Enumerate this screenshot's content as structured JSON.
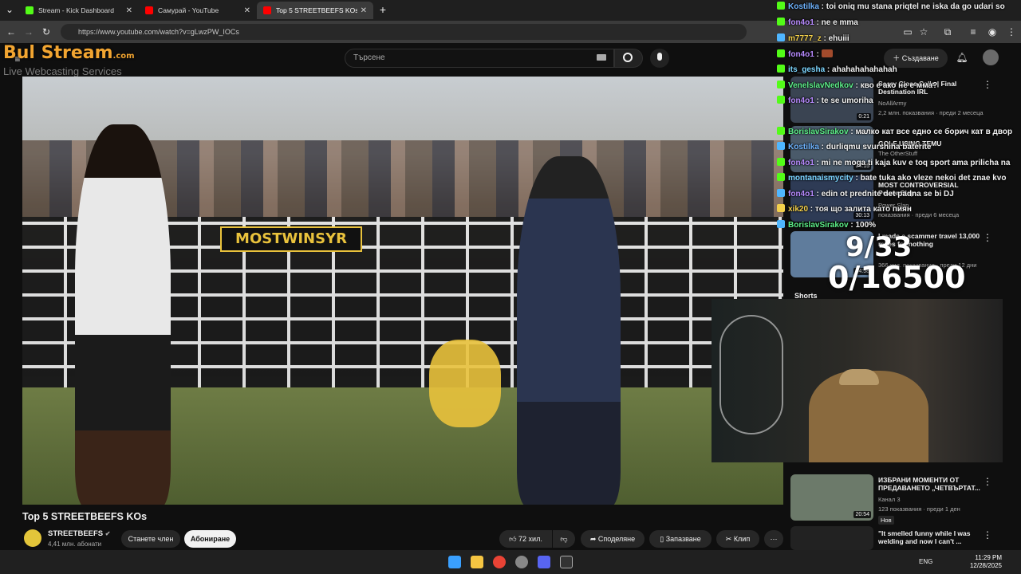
{
  "browser": {
    "tabs": [
      {
        "label": "Stream - Kick Dashboard",
        "icon": "kick-favicon",
        "color": "#53fc18"
      },
      {
        "label": "Самурай - YouTube",
        "icon": "youtube-favicon",
        "color": "#ff0000"
      },
      {
        "label": "Top 5 STREETBEEFS KOs - YouTube",
        "icon": "youtube-favicon",
        "color": "#ff0000"
      }
    ],
    "url": "https://www.youtube.com/watch?v=gLwzPW_IOCs"
  },
  "overlay": {
    "logo_text": "Bul Stream",
    "logo_domain": ".com",
    "logo_sub": "Live Webcasting Services",
    "counter_top": "9/33",
    "counter_bottom": "0/16500"
  },
  "youtube": {
    "search_placeholder": "Търсене",
    "create_label": "Създаване",
    "video": {
      "title": "Top 5 STREETBEEFS KOs",
      "banner_text": "MOSTWINSYR",
      "channel": "STREETBEEFS",
      "subscribers": "4,41 млн. абонати",
      "join_label": "Станете член",
      "subscribe_label": "Абониране",
      "likes": "72 хил.",
      "share_label": "Споделяне",
      "save_label": "Запазване",
      "clip_label": "Клип"
    },
    "recommendations": [
      {
        "title": "Scary Close Calls | Final Destination IRL",
        "meta1": "NoAllArmy",
        "meta2": "2,2 млн. показвания · преди 2 месеца",
        "duration": "0:21"
      },
      {
        "title": "GOLF USING TEMU",
        "meta1": "The OtherStuff",
        "meta2": "",
        "duration": "34:15"
      },
      {
        "title": "MOST CONTROVERSIAL Power Slap",
        "meta1": "Power Slap",
        "meta2": "показвания · преди 6 месеца",
        "duration": "30:13"
      },
      {
        "title": "I made a scammer travel 13,000 miles for nothing",
        "meta1": "",
        "meta2": "366 хил. показвания · преди 12 дни",
        "duration": "14:58"
      },
      {
        "title": "ИЗБРАНИ МОМЕНТИ ОТ ПРЕДАВАНЕТО „ЧЕТВЪРТАТ...",
        "meta1": "Канал 3",
        "meta2": "123 показвания · преди 1 ден",
        "badge": "Нов",
        "duration": "20:54"
      },
      {
        "title": "\"It smelled funny while I was welding and now I can't ...",
        "meta1": "",
        "meta2": "",
        "duration": ""
      }
    ],
    "shorts_label": "Shorts"
  },
  "chat": [
    {
      "user": "Kostilka",
      "text": "toi oniq mu stana priqtel ne iska da go udari so",
      "color": "#6fb4ff"
    },
    {
      "user": "fon4o1",
      "text": "ne e mma",
      "color": "#b88bff"
    },
    {
      "user": "m7777_z",
      "text": "ehuiii",
      "color": "#f3d04b"
    },
    {
      "user": "fon4o1",
      "text": "",
      "color": "#b88bff"
    },
    {
      "user": "its_gesha",
      "text": "ahahahahahahah",
      "color": "#7cd6ff"
    },
    {
      "user": "VenelslavNedkov",
      "text": "кво е ако не е мма?",
      "color": "#5df08a"
    },
    {
      "user": "fon4o1",
      "text": "te se umoriha",
      "color": "#b88bff"
    },
    {
      "user": "",
      "text": "",
      "color": "#ff6b6b"
    },
    {
      "user": "BorislavSirakov",
      "text": "малко кат все едно се борич кат в двор",
      "color": "#5df08a"
    },
    {
      "user": "Kostilka",
      "text": "durliqmu svurshiha baterite",
      "color": "#6fb4ff"
    },
    {
      "user": "fon4o1",
      "text": "mi ne moga ti kaja kuv e toq sport ama prilicha na",
      "color": "#b88bff"
    },
    {
      "user": "montanaismycity",
      "text": "bate tuka ako vleze nekoi det znae kvo",
      "color": "#7cd6ff"
    },
    {
      "user": "fon4o1",
      "text": "edin ot prednite det padna se bi DJ",
      "color": "#b88bff"
    },
    {
      "user": "xik20",
      "text": "тоя що залита като пиян",
      "color": "#f3d04b"
    },
    {
      "user": "BorislavSirakov",
      "text": "100%",
      "color": "#5df08a"
    }
  ],
  "taskbar": {
    "lang": "ENG",
    "time": "11:29 PM",
    "date": "12/28/2025"
  }
}
